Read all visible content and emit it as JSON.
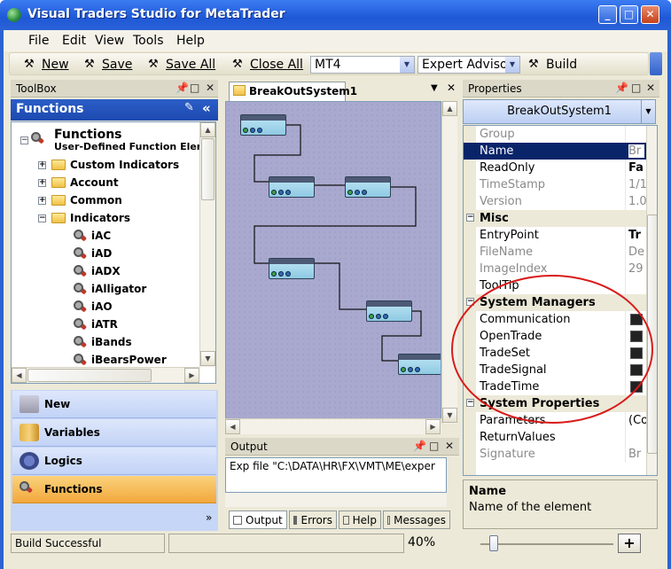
{
  "window": {
    "title": "Visual Traders Studio for MetaTrader",
    "minimize": "_",
    "maximize": "□",
    "close": "✕"
  },
  "menu": [
    "File",
    "Edit",
    "View",
    "Tools",
    "Help"
  ],
  "toolbar": {
    "new": "New",
    "save": "Save",
    "save_all": "Save All",
    "close_all": "Close All",
    "platform": "MT4",
    "mode": "Expert Advisor",
    "build": "Build"
  },
  "toolbox": {
    "title": "ToolBox",
    "section": "Functions",
    "root": "Functions",
    "root_sub": "User-Defined Function Elemen",
    "folders": [
      "Custom Indicators",
      "Account",
      "Common",
      "Indicators"
    ],
    "indicators": [
      "iAC",
      "iAD",
      "iADX",
      "iAlligator",
      "iAO",
      "iATR",
      "iBands",
      "iBearsPower"
    ],
    "nav": [
      "New",
      "Variables",
      "Logics",
      "Functions"
    ]
  },
  "document": {
    "tab": "BreakOutSystem1"
  },
  "output": {
    "title": "Output",
    "text": "Exp file \"C:\\DATA\\HR\\FX\\VMT\\ME\\exper",
    "tabs": [
      "Output",
      "Errors",
      "Help",
      "Messages"
    ]
  },
  "properties": {
    "title": "Properties",
    "object": "BreakOutSystem1",
    "rows": [
      {
        "name": "Group",
        "value": "",
        "disabled": true
      },
      {
        "name": "Name",
        "value": "Br",
        "disabled": false,
        "selected": true
      },
      {
        "name": "ReadOnly",
        "value": "Fa",
        "disabled": false
      },
      {
        "name": "TimeStamp",
        "value": "1/1",
        "disabled": true
      },
      {
        "name": "Version",
        "value": "1.0",
        "disabled": true
      }
    ],
    "misc_label": "Misc",
    "misc": [
      {
        "name": "EntryPoint",
        "value": "Tr",
        "disabled": false
      },
      {
        "name": "FileName",
        "value": "De",
        "disabled": true
      },
      {
        "name": "ImageIndex",
        "value": "29",
        "disabled": true
      },
      {
        "name": "ToolTip",
        "value": "",
        "disabled": false
      }
    ],
    "sysman_label": "System Managers",
    "sysman": [
      "Communication",
      "OpenTrade",
      "TradeSet",
      "TradeSignal",
      "TradeTime"
    ],
    "sysprops_label": "System Properties",
    "sysprops": [
      {
        "name": "Parameters",
        "value": "(Co",
        "disabled": false
      },
      {
        "name": "ReturnValues",
        "value": "",
        "disabled": false
      },
      {
        "name": "Signature",
        "value": "Br",
        "disabled": true
      }
    ],
    "desc_title": "Name",
    "desc_text": "Name of the element"
  },
  "status": {
    "text": "Build Successful",
    "zoom": "40%",
    "zoom_plus": "+"
  }
}
